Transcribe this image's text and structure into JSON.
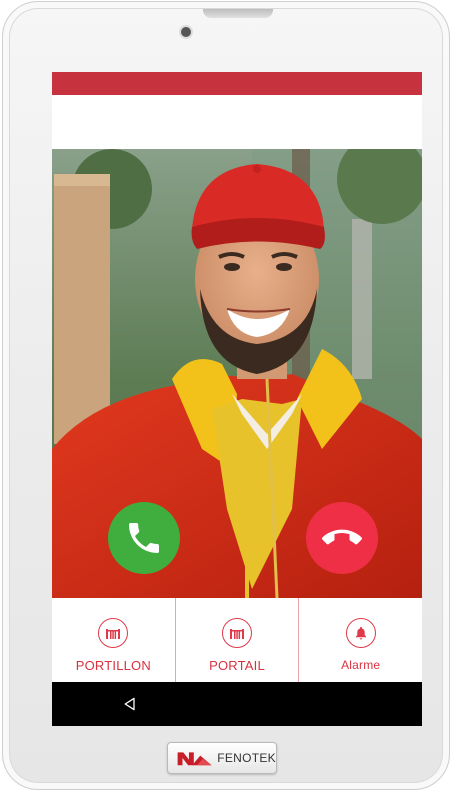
{
  "colors": {
    "accent_bar": "#c6323d",
    "accept": "#3fae3f",
    "reject": "#ef2f46",
    "control_red": "#d8323f",
    "navbar": "#000000"
  },
  "call": {
    "accept_icon": "phone-icon",
    "reject_icon": "phone-hangup-icon"
  },
  "controls": [
    {
      "label": "PORTILLON",
      "icon": "gate-icon"
    },
    {
      "label": "PORTAIL",
      "icon": "gate-icon"
    },
    {
      "label": "Alarme",
      "icon": "bell-icon"
    }
  ],
  "navbar": {
    "back_icon": "back-triangle-icon"
  },
  "brand": {
    "name": "FENOTEK"
  }
}
